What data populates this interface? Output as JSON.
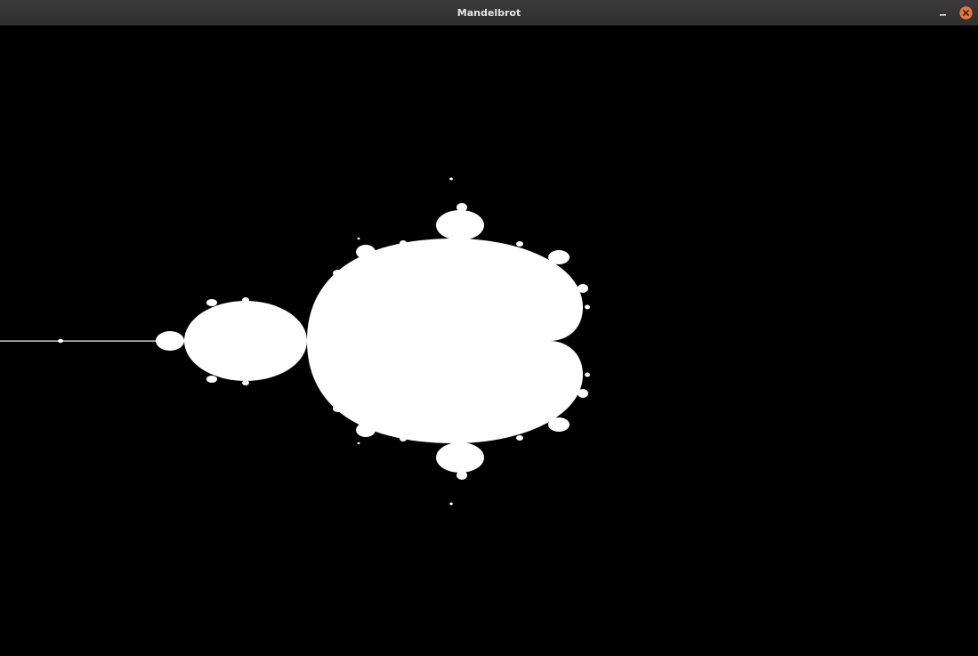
{
  "window": {
    "title": "Mandelbrot",
    "controls": {
      "minimize_icon": "minimize-icon",
      "close_icon": "close-icon"
    }
  },
  "render": {
    "background_color": "#000000",
    "set_color": "#ffffff",
    "close_button_color": "#e8753a"
  }
}
